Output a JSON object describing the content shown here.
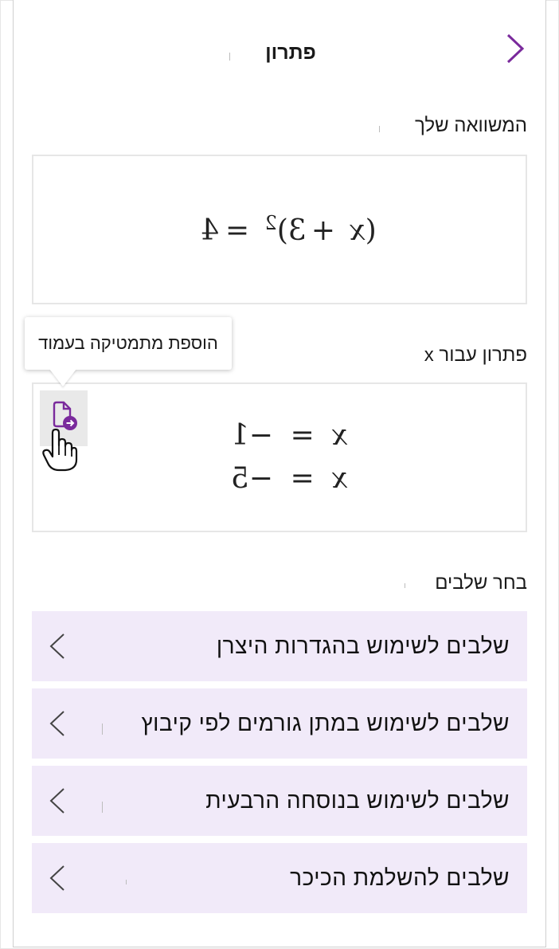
{
  "panel": {
    "title": "פתרון"
  },
  "equation_section": {
    "label": "המשוואה שלך",
    "equation": {
      "open_paren": "(",
      "var": "x",
      "plus": "+",
      "three": "3",
      "close_paren": ")",
      "exp": "2",
      "equals": "=",
      "rhs": "4"
    }
  },
  "solution_section": {
    "label": "פתרון עבור x",
    "tooltip": "הוספת מתמטיקה בעמוד",
    "solutions": [
      {
        "var": "x",
        "equals": "=",
        "value": "−1"
      },
      {
        "var": "x",
        "equals": "=",
        "value": "−5"
      }
    ]
  },
  "steps_section": {
    "label": "בחר שלבים",
    "items": [
      {
        "label": "שלבים לשימוש בהגדרות היצרן"
      },
      {
        "label": "שלבים לשימוש במתן גורמים לפי קיבוץ"
      },
      {
        "label": "שלבים לשימוש בנוסחה הרבעית"
      },
      {
        "label": "שלבים להשלמת הכיכר"
      }
    ]
  },
  "colors": {
    "accent": "#7a2a9c",
    "step_bg": "#f1eaf9",
    "card_border": "#e6e6e6"
  },
  "icons": {
    "back": "chevron-right-icon",
    "add_to_page": "page-arrow-icon",
    "cursor": "hand-pointer-icon",
    "step_expand": "chevron-left-icon"
  }
}
